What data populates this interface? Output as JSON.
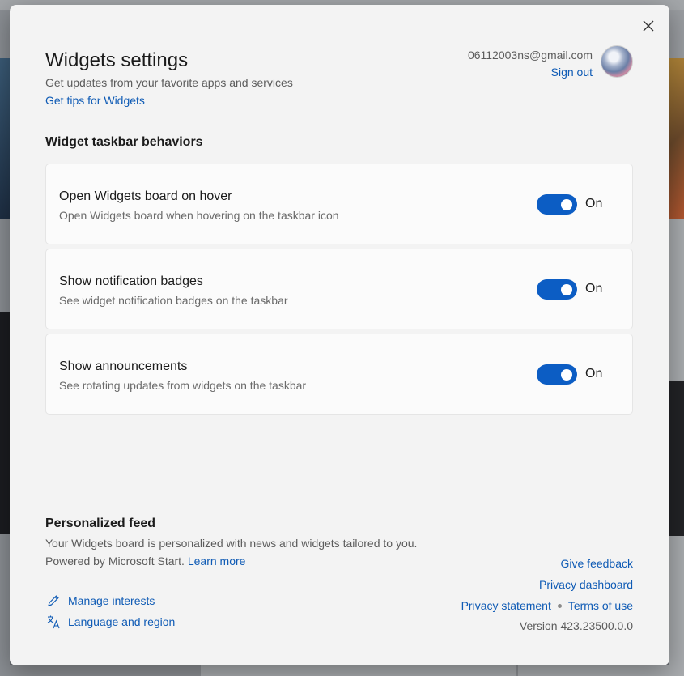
{
  "dialog": {
    "title": "Widgets settings",
    "subtitle": "Get updates from your favorite apps and services",
    "tips_link": "Get tips for Widgets",
    "close_icon": "close-icon"
  },
  "account": {
    "email": "06112003ns@gmail.com",
    "sign_out": "Sign out"
  },
  "taskbar_section": {
    "title": "Widget taskbar behaviors",
    "items": [
      {
        "title": "Open Widgets board on hover",
        "description": "Open Widgets board when hovering on the taskbar icon",
        "state": "On"
      },
      {
        "title": "Show notification badges",
        "description": "See widget notification badges on the taskbar",
        "state": "On"
      },
      {
        "title": "Show announcements",
        "description": "See rotating updates from widgets on the taskbar",
        "state": "On"
      }
    ]
  },
  "feed": {
    "title": "Personalized feed",
    "description": "Your Widgets board is personalized with news and widgets tailored to you. Powered by Microsoft Start.",
    "learn_more": "Learn more",
    "manage_interests": "Manage interests",
    "language_region": "Language and region"
  },
  "links": {
    "give_feedback": "Give feedback",
    "privacy_dashboard": "Privacy dashboard",
    "privacy_statement": "Privacy statement",
    "terms_of_use": "Terms of use",
    "version": "Version 423.23500.0.0"
  },
  "colors": {
    "accent": "#0c5dc4",
    "link": "#0f5bb5",
    "dialog_bg": "#f3f3f3",
    "card_bg": "#fbfbfb"
  }
}
